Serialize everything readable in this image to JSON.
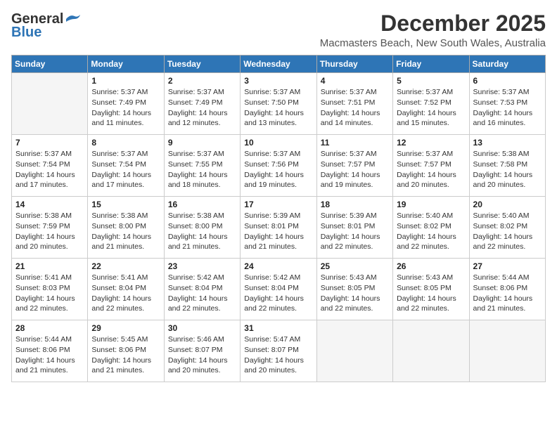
{
  "header": {
    "logo_general": "General",
    "logo_blue": "Blue",
    "month": "December 2025",
    "location": "Macmasters Beach, New South Wales, Australia"
  },
  "weekdays": [
    "Sunday",
    "Monday",
    "Tuesday",
    "Wednesday",
    "Thursday",
    "Friday",
    "Saturday"
  ],
  "weeks": [
    [
      {
        "day": "",
        "detail": ""
      },
      {
        "day": "1",
        "detail": "Sunrise: 5:37 AM\nSunset: 7:49 PM\nDaylight: 14 hours\nand 11 minutes."
      },
      {
        "day": "2",
        "detail": "Sunrise: 5:37 AM\nSunset: 7:49 PM\nDaylight: 14 hours\nand 12 minutes."
      },
      {
        "day": "3",
        "detail": "Sunrise: 5:37 AM\nSunset: 7:50 PM\nDaylight: 14 hours\nand 13 minutes."
      },
      {
        "day": "4",
        "detail": "Sunrise: 5:37 AM\nSunset: 7:51 PM\nDaylight: 14 hours\nand 14 minutes."
      },
      {
        "day": "5",
        "detail": "Sunrise: 5:37 AM\nSunset: 7:52 PM\nDaylight: 14 hours\nand 15 minutes."
      },
      {
        "day": "6",
        "detail": "Sunrise: 5:37 AM\nSunset: 7:53 PM\nDaylight: 14 hours\nand 16 minutes."
      }
    ],
    [
      {
        "day": "7",
        "detail": "Sunrise: 5:37 AM\nSunset: 7:54 PM\nDaylight: 14 hours\nand 17 minutes."
      },
      {
        "day": "8",
        "detail": "Sunrise: 5:37 AM\nSunset: 7:54 PM\nDaylight: 14 hours\nand 17 minutes."
      },
      {
        "day": "9",
        "detail": "Sunrise: 5:37 AM\nSunset: 7:55 PM\nDaylight: 14 hours\nand 18 minutes."
      },
      {
        "day": "10",
        "detail": "Sunrise: 5:37 AM\nSunset: 7:56 PM\nDaylight: 14 hours\nand 19 minutes."
      },
      {
        "day": "11",
        "detail": "Sunrise: 5:37 AM\nSunset: 7:57 PM\nDaylight: 14 hours\nand 19 minutes."
      },
      {
        "day": "12",
        "detail": "Sunrise: 5:37 AM\nSunset: 7:57 PM\nDaylight: 14 hours\nand 20 minutes."
      },
      {
        "day": "13",
        "detail": "Sunrise: 5:38 AM\nSunset: 7:58 PM\nDaylight: 14 hours\nand 20 minutes."
      }
    ],
    [
      {
        "day": "14",
        "detail": "Sunrise: 5:38 AM\nSunset: 7:59 PM\nDaylight: 14 hours\nand 20 minutes."
      },
      {
        "day": "15",
        "detail": "Sunrise: 5:38 AM\nSunset: 8:00 PM\nDaylight: 14 hours\nand 21 minutes."
      },
      {
        "day": "16",
        "detail": "Sunrise: 5:38 AM\nSunset: 8:00 PM\nDaylight: 14 hours\nand 21 minutes."
      },
      {
        "day": "17",
        "detail": "Sunrise: 5:39 AM\nSunset: 8:01 PM\nDaylight: 14 hours\nand 21 minutes."
      },
      {
        "day": "18",
        "detail": "Sunrise: 5:39 AM\nSunset: 8:01 PM\nDaylight: 14 hours\nand 22 minutes."
      },
      {
        "day": "19",
        "detail": "Sunrise: 5:40 AM\nSunset: 8:02 PM\nDaylight: 14 hours\nand 22 minutes."
      },
      {
        "day": "20",
        "detail": "Sunrise: 5:40 AM\nSunset: 8:02 PM\nDaylight: 14 hours\nand 22 minutes."
      }
    ],
    [
      {
        "day": "21",
        "detail": "Sunrise: 5:41 AM\nSunset: 8:03 PM\nDaylight: 14 hours\nand 22 minutes."
      },
      {
        "day": "22",
        "detail": "Sunrise: 5:41 AM\nSunset: 8:04 PM\nDaylight: 14 hours\nand 22 minutes."
      },
      {
        "day": "23",
        "detail": "Sunrise: 5:42 AM\nSunset: 8:04 PM\nDaylight: 14 hours\nand 22 minutes."
      },
      {
        "day": "24",
        "detail": "Sunrise: 5:42 AM\nSunset: 8:04 PM\nDaylight: 14 hours\nand 22 minutes."
      },
      {
        "day": "25",
        "detail": "Sunrise: 5:43 AM\nSunset: 8:05 PM\nDaylight: 14 hours\nand 22 minutes."
      },
      {
        "day": "26",
        "detail": "Sunrise: 5:43 AM\nSunset: 8:05 PM\nDaylight: 14 hours\nand 22 minutes."
      },
      {
        "day": "27",
        "detail": "Sunrise: 5:44 AM\nSunset: 8:06 PM\nDaylight: 14 hours\nand 21 minutes."
      }
    ],
    [
      {
        "day": "28",
        "detail": "Sunrise: 5:44 AM\nSunset: 8:06 PM\nDaylight: 14 hours\nand 21 minutes."
      },
      {
        "day": "29",
        "detail": "Sunrise: 5:45 AM\nSunset: 8:06 PM\nDaylight: 14 hours\nand 21 minutes."
      },
      {
        "day": "30",
        "detail": "Sunrise: 5:46 AM\nSunset: 8:07 PM\nDaylight: 14 hours\nand 20 minutes."
      },
      {
        "day": "31",
        "detail": "Sunrise: 5:47 AM\nSunset: 8:07 PM\nDaylight: 14 hours\nand 20 minutes."
      },
      {
        "day": "",
        "detail": ""
      },
      {
        "day": "",
        "detail": ""
      },
      {
        "day": "",
        "detail": ""
      }
    ]
  ]
}
